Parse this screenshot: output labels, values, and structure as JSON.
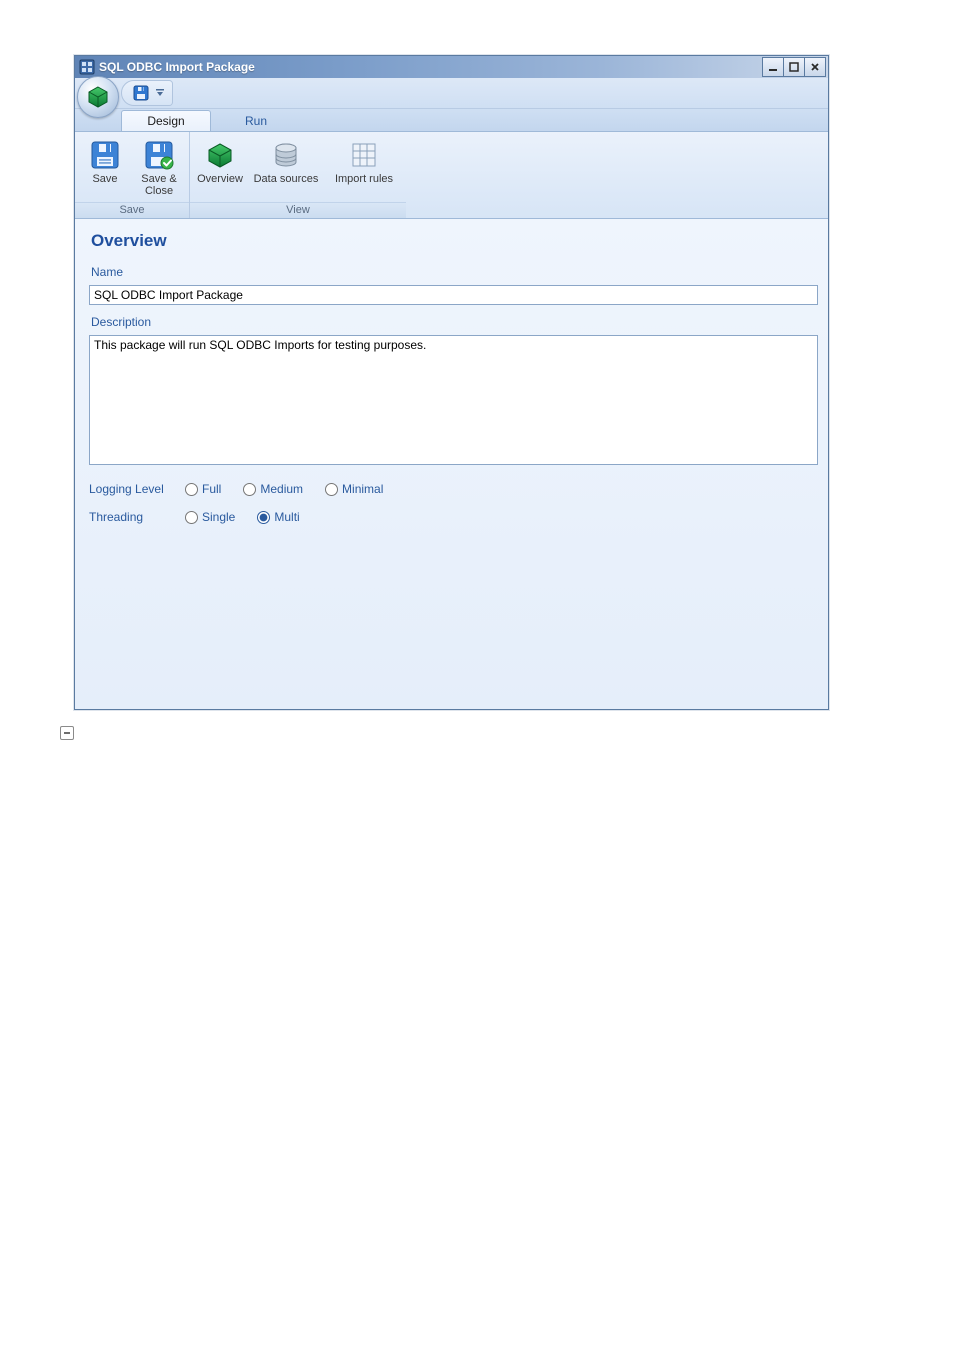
{
  "window": {
    "title": "SQL ODBC Import Package"
  },
  "ribbon": {
    "tabs": {
      "design": "Design",
      "run": "Run"
    },
    "groups": {
      "save": {
        "caption": "Save",
        "save": "Save",
        "save_close": "Save & Close"
      },
      "view": {
        "caption": "View",
        "overview": "Overview",
        "data_sources": "Data sources",
        "import_rules": "Import rules"
      }
    }
  },
  "content": {
    "section_title": "Overview",
    "name_label": "Name",
    "name_value": "SQL ODBC Import Package",
    "description_label": "Description",
    "description_value": "This package will run SQL ODBC Imports for testing purposes.",
    "logging_level": {
      "label": "Logging Level",
      "options": {
        "full": "Full",
        "medium": "Medium",
        "minimal": "Minimal"
      }
    },
    "threading": {
      "label": "Threading",
      "options": {
        "single": "Single",
        "multi": "Multi"
      }
    }
  }
}
